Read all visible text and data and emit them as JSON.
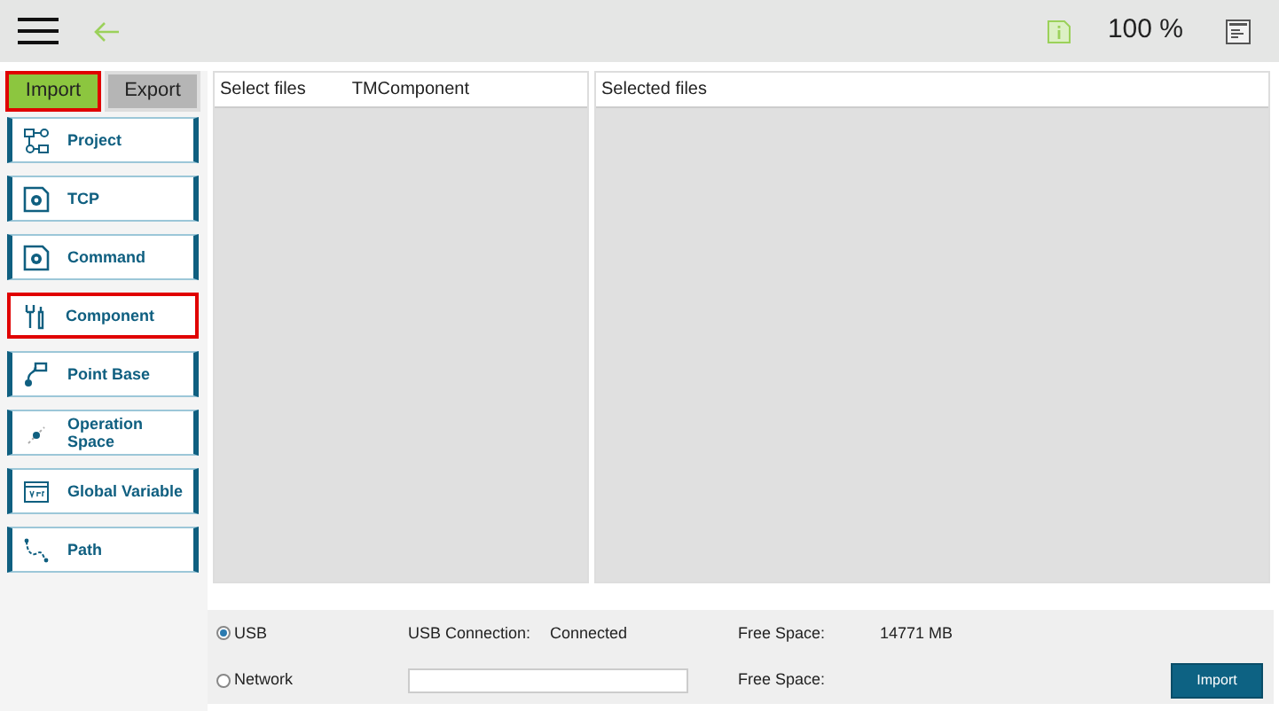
{
  "toolbar": {
    "zoom": "100 %"
  },
  "tabs": [
    {
      "label": "Import",
      "selected": true,
      "highlighted": true
    },
    {
      "label": "Export",
      "selected": false,
      "highlighted": false
    }
  ],
  "sidebar": {
    "items": [
      {
        "label": "Project",
        "highlighted": false
      },
      {
        "label": "TCP",
        "highlighted": false
      },
      {
        "label": "Command",
        "highlighted": false
      },
      {
        "label": "Component",
        "highlighted": true
      },
      {
        "label": "Point Base",
        "highlighted": false
      },
      {
        "label": "Operation Space",
        "highlighted": false
      },
      {
        "label": "Global Variable",
        "highlighted": false
      },
      {
        "label": "Path",
        "highlighted": false
      }
    ]
  },
  "select_panel": {
    "title": "Select files",
    "folder": "TMComponent"
  },
  "selected_panel": {
    "title": "Selected files"
  },
  "source": {
    "options": [
      {
        "label": "USB",
        "selected": true
      },
      {
        "label": "Network",
        "selected": false
      }
    ],
    "usb_connection_label": "USB Connection:",
    "usb_connection_value": "Connected",
    "free_space_label_1": "Free Space:",
    "free_space_value_1": "14771 MB",
    "free_space_label_2": "Free Space:",
    "import_button": "Import"
  }
}
